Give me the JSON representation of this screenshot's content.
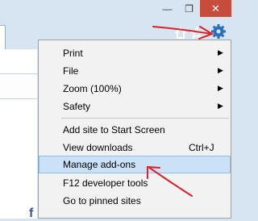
{
  "window": {
    "minimize_glyph": "—",
    "restore_glyph": "❐",
    "close_glyph": "✕"
  },
  "toolbar": {
    "icons": [
      "home-icon",
      "star-icon",
      "gear-icon"
    ]
  },
  "page": {
    "partial_letter": "f"
  },
  "menu": {
    "items": [
      {
        "label": "Print",
        "submenu": true
      },
      {
        "label": "File",
        "submenu": true
      },
      {
        "label": "Zoom (100%)",
        "submenu": true
      },
      {
        "label": "Safety",
        "submenu": true
      },
      {
        "label": "Add site to Start Screen"
      },
      {
        "label": "View downloads",
        "shortcut": "Ctrl+J"
      },
      {
        "label": "Manage add-ons",
        "highlighted": true
      },
      {
        "label": "F12 developer tools"
      },
      {
        "label": "Go to pinned sites"
      }
    ],
    "submenu_arrow": "▶"
  },
  "colors": {
    "annotation_arrow": "#d9232a",
    "highlight": "#cbe1f8",
    "close_button": "#c74c3c"
  }
}
